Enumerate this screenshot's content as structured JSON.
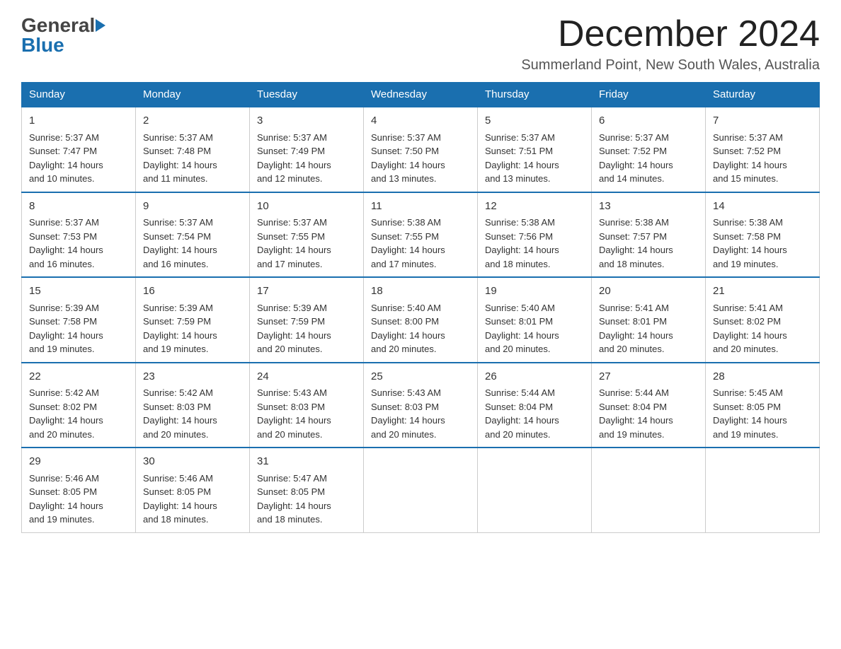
{
  "logo": {
    "general": "General",
    "blue": "Blue",
    "arrow": "▶"
  },
  "header": {
    "month_title": "December 2024",
    "subtitle": "Summerland Point, New South Wales, Australia"
  },
  "weekdays": [
    "Sunday",
    "Monday",
    "Tuesday",
    "Wednesday",
    "Thursday",
    "Friday",
    "Saturday"
  ],
  "weeks": [
    [
      {
        "day": "1",
        "sunrise": "5:37 AM",
        "sunset": "7:47 PM",
        "daylight": "14 hours and 10 minutes."
      },
      {
        "day": "2",
        "sunrise": "5:37 AM",
        "sunset": "7:48 PM",
        "daylight": "14 hours and 11 minutes."
      },
      {
        "day": "3",
        "sunrise": "5:37 AM",
        "sunset": "7:49 PM",
        "daylight": "14 hours and 12 minutes."
      },
      {
        "day": "4",
        "sunrise": "5:37 AM",
        "sunset": "7:50 PM",
        "daylight": "14 hours and 13 minutes."
      },
      {
        "day": "5",
        "sunrise": "5:37 AM",
        "sunset": "7:51 PM",
        "daylight": "14 hours and 13 minutes."
      },
      {
        "day": "6",
        "sunrise": "5:37 AM",
        "sunset": "7:52 PM",
        "daylight": "14 hours and 14 minutes."
      },
      {
        "day": "7",
        "sunrise": "5:37 AM",
        "sunset": "7:52 PM",
        "daylight": "14 hours and 15 minutes."
      }
    ],
    [
      {
        "day": "8",
        "sunrise": "5:37 AM",
        "sunset": "7:53 PM",
        "daylight": "14 hours and 16 minutes."
      },
      {
        "day": "9",
        "sunrise": "5:37 AM",
        "sunset": "7:54 PM",
        "daylight": "14 hours and 16 minutes."
      },
      {
        "day": "10",
        "sunrise": "5:37 AM",
        "sunset": "7:55 PM",
        "daylight": "14 hours and 17 minutes."
      },
      {
        "day": "11",
        "sunrise": "5:38 AM",
        "sunset": "7:55 PM",
        "daylight": "14 hours and 17 minutes."
      },
      {
        "day": "12",
        "sunrise": "5:38 AM",
        "sunset": "7:56 PM",
        "daylight": "14 hours and 18 minutes."
      },
      {
        "day": "13",
        "sunrise": "5:38 AM",
        "sunset": "7:57 PM",
        "daylight": "14 hours and 18 minutes."
      },
      {
        "day": "14",
        "sunrise": "5:38 AM",
        "sunset": "7:58 PM",
        "daylight": "14 hours and 19 minutes."
      }
    ],
    [
      {
        "day": "15",
        "sunrise": "5:39 AM",
        "sunset": "7:58 PM",
        "daylight": "14 hours and 19 minutes."
      },
      {
        "day": "16",
        "sunrise": "5:39 AM",
        "sunset": "7:59 PM",
        "daylight": "14 hours and 19 minutes."
      },
      {
        "day": "17",
        "sunrise": "5:39 AM",
        "sunset": "7:59 PM",
        "daylight": "14 hours and 20 minutes."
      },
      {
        "day": "18",
        "sunrise": "5:40 AM",
        "sunset": "8:00 PM",
        "daylight": "14 hours and 20 minutes."
      },
      {
        "day": "19",
        "sunrise": "5:40 AM",
        "sunset": "8:01 PM",
        "daylight": "14 hours and 20 minutes."
      },
      {
        "day": "20",
        "sunrise": "5:41 AM",
        "sunset": "8:01 PM",
        "daylight": "14 hours and 20 minutes."
      },
      {
        "day": "21",
        "sunrise": "5:41 AM",
        "sunset": "8:02 PM",
        "daylight": "14 hours and 20 minutes."
      }
    ],
    [
      {
        "day": "22",
        "sunrise": "5:42 AM",
        "sunset": "8:02 PM",
        "daylight": "14 hours and 20 minutes."
      },
      {
        "day": "23",
        "sunrise": "5:42 AM",
        "sunset": "8:03 PM",
        "daylight": "14 hours and 20 minutes."
      },
      {
        "day": "24",
        "sunrise": "5:43 AM",
        "sunset": "8:03 PM",
        "daylight": "14 hours and 20 minutes."
      },
      {
        "day": "25",
        "sunrise": "5:43 AM",
        "sunset": "8:03 PM",
        "daylight": "14 hours and 20 minutes."
      },
      {
        "day": "26",
        "sunrise": "5:44 AM",
        "sunset": "8:04 PM",
        "daylight": "14 hours and 20 minutes."
      },
      {
        "day": "27",
        "sunrise": "5:44 AM",
        "sunset": "8:04 PM",
        "daylight": "14 hours and 19 minutes."
      },
      {
        "day": "28",
        "sunrise": "5:45 AM",
        "sunset": "8:05 PM",
        "daylight": "14 hours and 19 minutes."
      }
    ],
    [
      {
        "day": "29",
        "sunrise": "5:46 AM",
        "sunset": "8:05 PM",
        "daylight": "14 hours and 19 minutes."
      },
      {
        "day": "30",
        "sunrise": "5:46 AM",
        "sunset": "8:05 PM",
        "daylight": "14 hours and 18 minutes."
      },
      {
        "day": "31",
        "sunrise": "5:47 AM",
        "sunset": "8:05 PM",
        "daylight": "14 hours and 18 minutes."
      },
      null,
      null,
      null,
      null
    ]
  ],
  "labels": {
    "sunrise": "Sunrise:",
    "sunset": "Sunset:",
    "daylight": "Daylight:"
  }
}
